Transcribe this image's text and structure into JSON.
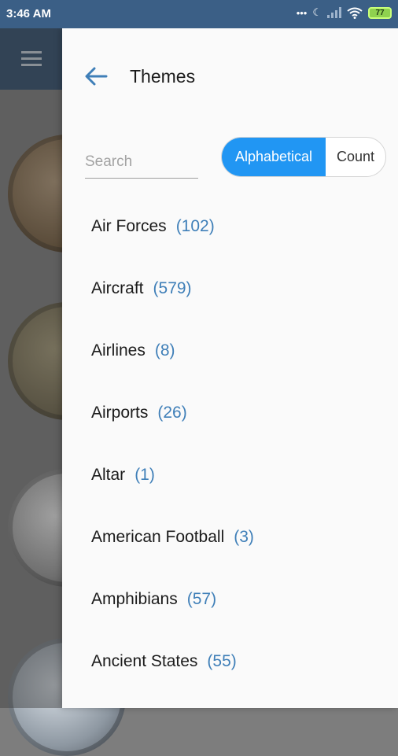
{
  "status_bar": {
    "time": "3:46 AM",
    "battery": "77",
    "icons": [
      "dots-icon",
      "moon-icon",
      "signal-icon",
      "wifi-icon",
      "battery-icon"
    ]
  },
  "drawer": {
    "title": "Themes",
    "search_placeholder": "Search",
    "sort_options": {
      "alphabetical": "Alphabetical",
      "count": "Count",
      "selected": "Alphabetical"
    },
    "items": [
      {
        "name": "Air Forces",
        "count": "(102)"
      },
      {
        "name": "Aircraft",
        "count": "(579)"
      },
      {
        "name": "Airlines",
        "count": "(8)"
      },
      {
        "name": "Airports",
        "count": "(26)"
      },
      {
        "name": "Altar",
        "count": "(1)"
      },
      {
        "name": "American Football",
        "count": "(3)"
      },
      {
        "name": "Amphibians",
        "count": "(57)"
      },
      {
        "name": "Ancient States",
        "count": "(55)"
      }
    ]
  },
  "colors": {
    "status_bar": "#3b5f86",
    "accent": "#2196f3",
    "count_text": "#3f7fb8",
    "drawer_bg": "#fafafa"
  }
}
